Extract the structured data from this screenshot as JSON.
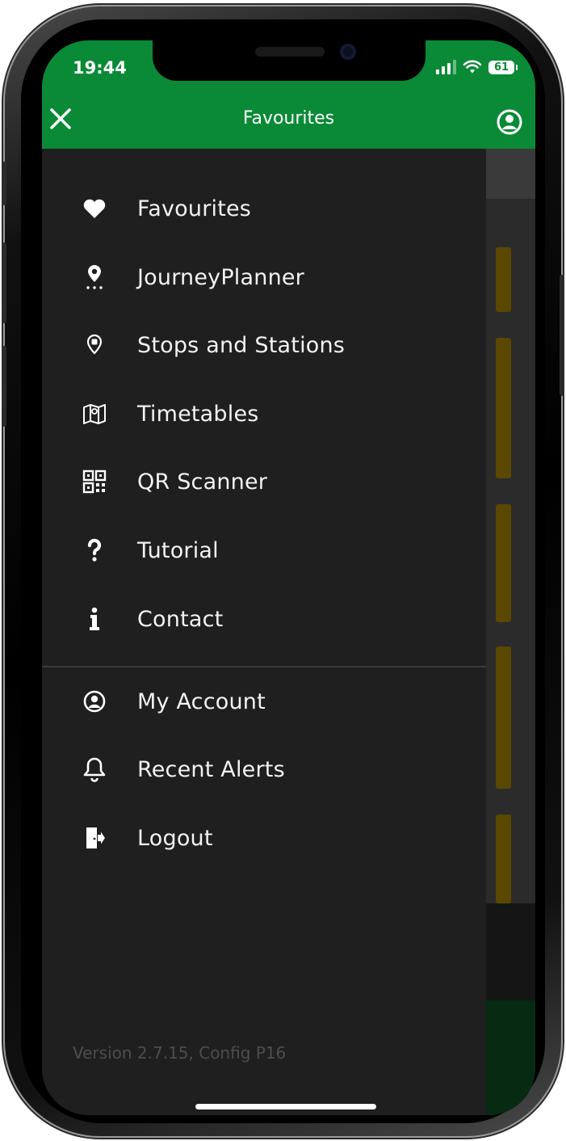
{
  "status": {
    "time": "19:44",
    "battery": "61"
  },
  "header": {
    "title": "Favourites"
  },
  "menu": {
    "items": [
      {
        "label": "Favourites",
        "icon": "heart-icon"
      },
      {
        "label": "JourneyPlanner",
        "icon": "location-pin-icon"
      },
      {
        "label": "Stops and Stations",
        "icon": "stop-pin-icon"
      },
      {
        "label": "Timetables",
        "icon": "map-icon"
      },
      {
        "label": "QR Scanner",
        "icon": "qr-code-icon"
      },
      {
        "label": "Tutorial",
        "icon": "question-icon"
      },
      {
        "label": "Contact",
        "icon": "info-icon"
      },
      {
        "label": "My Account",
        "icon": "user-circle-icon"
      },
      {
        "label": "Recent Alerts",
        "icon": "bell-icon"
      },
      {
        "label": "Logout",
        "icon": "logout-icon"
      }
    ]
  },
  "footer": {
    "version": "Version 2.7.15, Config P16"
  },
  "colors": {
    "header_bg": "#0a8a36",
    "drawer_bg": "#1f1f1f",
    "text": "#f2f2f2",
    "version_text": "#4d4d4d"
  }
}
